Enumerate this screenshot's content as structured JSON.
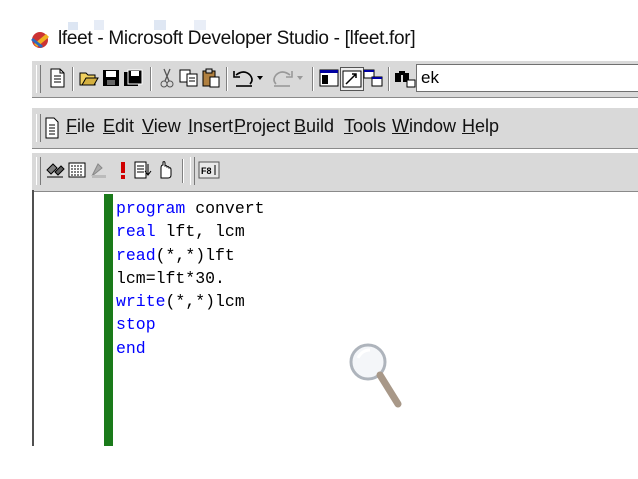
{
  "window": {
    "title": "lfeet - Microsoft Developer Studio - [lfeet.for]"
  },
  "standard_toolbar": {
    "buttons": [
      "new-document-icon",
      "open-folder-icon",
      "save-icon",
      "save-all-icon",
      "cut-icon",
      "copy-icon",
      "paste-icon",
      "undo-icon",
      "redo-icon",
      "workspace-icon",
      "output-window-icon",
      "window-list-icon",
      "find-in-files-icon"
    ],
    "find_value": "ek"
  },
  "menubar": {
    "items": [
      {
        "label": "File",
        "accel": "F",
        "rest": "ile"
      },
      {
        "label": "Edit",
        "accel": "E",
        "rest": "dit"
      },
      {
        "label": "View",
        "accel": "V",
        "rest": "iew"
      },
      {
        "label": "Insert",
        "accel": "I",
        "rest": "nsert"
      },
      {
        "label": "Project",
        "accel": "P",
        "rest": "roject"
      },
      {
        "label": "Build",
        "accel": "B",
        "rest": "uild"
      },
      {
        "label": "Tools",
        "accel": "T",
        "rest": "ools"
      },
      {
        "label": "Window",
        "accel": "W",
        "rest": "indow"
      },
      {
        "label": "Help",
        "accel": "H",
        "rest": "elp"
      }
    ]
  },
  "build_toolbar": {
    "buttons": [
      "compile-icon",
      "build-icon",
      "stop-build-icon",
      "execute-icon",
      "toggle-breakpoint-icon",
      "go-icon"
    ],
    "f8_label": "F8"
  },
  "editor": {
    "lines": [
      {
        "kw": "program",
        "rest": " convert"
      },
      {
        "kw": "real",
        "rest": " lft, lcm"
      },
      {
        "kw": "read",
        "rest": "(*,*)lft"
      },
      {
        "kw": "",
        "rest": "lcm=lft*30."
      },
      {
        "kw": "write",
        "rest": "(*,*)lcm"
      },
      {
        "kw": "stop",
        "rest": ""
      },
      {
        "kw": "end",
        "rest": ""
      }
    ]
  },
  "colors": {
    "keyword": "#0000ff",
    "gutter": "#1a7a1a",
    "toolbar_bg": "#d9d9d9"
  }
}
